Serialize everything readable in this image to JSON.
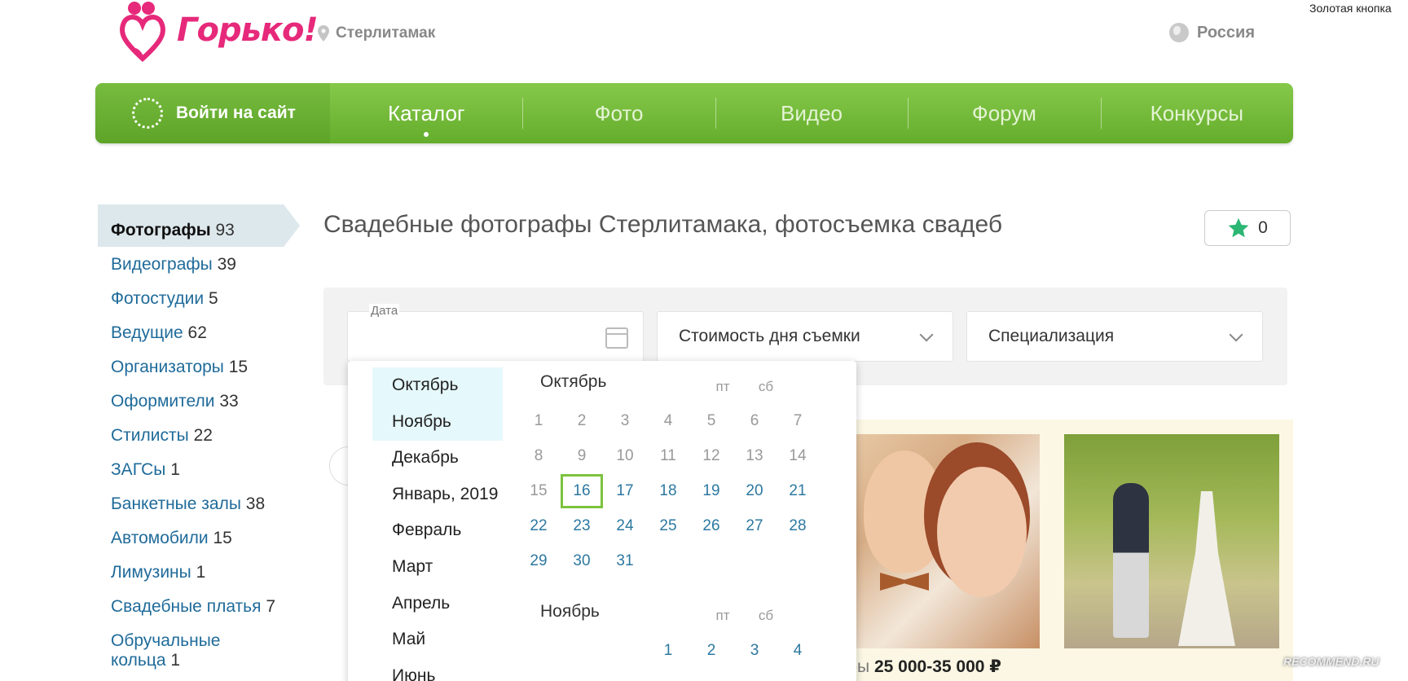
{
  "header": {
    "logo_text": "Горько!",
    "city": "Стерлитамак",
    "country": "Россия",
    "golden_button": "Золотая кнопка"
  },
  "nav": {
    "login": "Войти на сайт",
    "items": [
      {
        "label": "Каталог",
        "active": true
      },
      {
        "label": "Фото"
      },
      {
        "label": "Видео"
      },
      {
        "label": "Форум"
      },
      {
        "label": "Конкурсы"
      }
    ]
  },
  "sidebar": {
    "items": [
      {
        "label": "Фотографы",
        "count": "93",
        "active": true
      },
      {
        "label": "Видеографы",
        "count": "39"
      },
      {
        "label": "Фотостудии",
        "count": "5"
      },
      {
        "label": "Ведущие",
        "count": "62"
      },
      {
        "label": "Организаторы",
        "count": "15"
      },
      {
        "label": "Оформители",
        "count": "33"
      },
      {
        "label": "Стилисты",
        "count": "22"
      },
      {
        "label": "ЗАГСы",
        "count": "1"
      },
      {
        "label": "Банкетные залы",
        "count": "38"
      },
      {
        "label": "Автомобили",
        "count": "15"
      },
      {
        "label": "Лимузины",
        "count": "1"
      },
      {
        "label": "Свадебные платья",
        "count": "7"
      },
      {
        "label": "Обручальные",
        "label2": "кольца",
        "count": "1"
      }
    ]
  },
  "main": {
    "title": "Свадебные фотографы Стерлитамака, фотосъемка свадеб",
    "favorites_count": "0"
  },
  "filters": {
    "date_label": "Дата",
    "cost": "Стоимость дня съемки",
    "specialization": "Специализация"
  },
  "calendar": {
    "months_list": [
      "Октябрь",
      "Ноябрь",
      "Декабрь",
      "Январь, 2019",
      "Февраль",
      "Март",
      "Апрель",
      "Май",
      "Июнь"
    ],
    "selected_months": [
      "Октябрь",
      "Ноябрь"
    ],
    "october": {
      "title": "Октябрь",
      "dow": [
        "пт",
        "сб"
      ],
      "rows": [
        [
          "1",
          "2",
          "3",
          "4",
          "5",
          "6",
          "7"
        ],
        [
          "8",
          "9",
          "10",
          "11",
          "12",
          "13",
          "14"
        ],
        [
          "15",
          "16",
          "17",
          "18",
          "19",
          "20",
          "21"
        ],
        [
          "22",
          "23",
          "24",
          "25",
          "26",
          "27",
          "28"
        ],
        [
          "29",
          "30",
          "31"
        ]
      ],
      "today": "16"
    },
    "november": {
      "title": "Ноябрь",
      "dow": [
        "пт",
        "сб"
      ],
      "first_row": [
        "1",
        "2",
        "3",
        "4"
      ]
    }
  },
  "card": {
    "price_prefix": "бы",
    "price": "25 000-35 000 ₽"
  },
  "watermark": "RECOMMEND.RU",
  "colors": {
    "brand_pink": "#e6297a",
    "nav_green": "#6bb232",
    "link_blue": "#1f6b9a",
    "today_border": "#7cc23e"
  }
}
